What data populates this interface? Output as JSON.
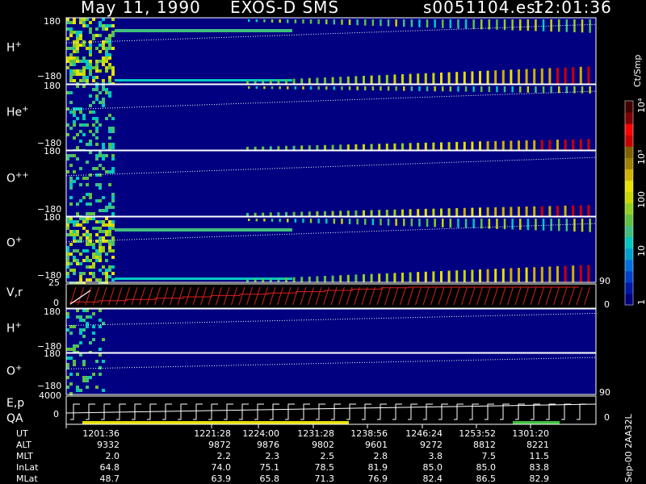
{
  "header": {
    "date": "May 11, 1990",
    "mission": "EXOS-D SMS",
    "file": "s0051104.esr",
    "time": "12:01:36"
  },
  "colorbar": {
    "unit": "Ct/Smp",
    "ticks": [
      "1",
      "10",
      "100",
      "10³",
      "10⁴"
    ],
    "colors": [
      "#000080",
      "#0018a8",
      "#0040d0",
      "#0070e0",
      "#00a0d0",
      "#00c8c0",
      "#40c080",
      "#60c040",
      "#90d020",
      "#c8d800",
      "#e8e000",
      "#d0b000",
      "#a08000",
      "#806000",
      "#cc0000",
      "#ff0000",
      "#800000",
      "#400000"
    ]
  },
  "panels": [
    {
      "label_main": "H",
      "label_sup": "+",
      "tick_top": "180",
      "tick_bottom": "−180"
    },
    {
      "label_main": "He",
      "label_sup": "+",
      "tick_top": "180",
      "tick_bottom": "−180"
    },
    {
      "label_main": "O",
      "label_sup": "++",
      "tick_top": "180",
      "tick_bottom": "−180"
    },
    {
      "label_main": "O",
      "label_sup": "+",
      "tick_top": "180",
      "tick_bottom": "−180",
      "right_tick": "90"
    },
    {
      "label_main": "V,r",
      "label_sup": "",
      "tick_top": "25",
      "tick_bottom": "0",
      "right_tick": "0"
    },
    {
      "label_main": "H",
      "label_sup": "+",
      "tick_top": "180",
      "tick_bottom": "−180"
    },
    {
      "label_main": "O",
      "label_sup": "+",
      "tick_top": "180",
      "tick_bottom": "−180",
      "right_tick": "90"
    },
    {
      "label_main": "E,p",
      "label_sub2": "QA",
      "tick_top": "4000",
      "tick_bottom": "0",
      "right_tick": "0"
    }
  ],
  "orbit_table": {
    "row_labels": [
      "UT",
      "ALT",
      "MLT",
      "InLat",
      "MLat"
    ],
    "columns": [
      {
        "UT": "1201:36",
        "ALT": "9332",
        "MLT": "2.0",
        "InLat": "64.8",
        "MLat": "48.7"
      },
      {
        "UT": "1221:28",
        "ALT": "9872",
        "MLT": "2.2",
        "InLat": "74.0",
        "MLat": "63.9"
      },
      {
        "UT": "1224:00",
        "ALT": "9876",
        "MLT": "2.3",
        "InLat": "75.1",
        "MLat": "65.8"
      },
      {
        "UT": "1231:28",
        "ALT": "9802",
        "MLT": "2.5",
        "InLat": "78.5",
        "MLat": "71.3"
      },
      {
        "UT": "1238:56",
        "ALT": "9601",
        "MLT": "2.8",
        "InLat": "81.9",
        "MLat": "76.9"
      },
      {
        "UT": "1246:24",
        "ALT": "9272",
        "MLT": "3.8",
        "InLat": "85.0",
        "MLat": "82.4"
      },
      {
        "UT": "1253:52",
        "ALT": "8812",
        "MLT": "7.5",
        "InLat": "85.0",
        "MLat": "86.5"
      },
      {
        "UT": "1301:20",
        "ALT": "8221",
        "MLT": "11.5",
        "InLat": "83.8",
        "MLat": "82.9"
      }
    ]
  },
  "side_note": "Sep-00 2AA32L",
  "chart_data": {
    "type": "heatmap",
    "title": "May 11, 1990 EXOS-D SMS",
    "x_time_labels": [
      "1201:36",
      "1221:28",
      "1224:00",
      "1231:28",
      "1238:56",
      "1246:24",
      "1253:52",
      "1301:20"
    ],
    "y_range_pitch": [
      -180,
      180
    ],
    "y_range_vr": [
      0,
      25
    ],
    "y_range_ep": [
      0,
      4000
    ],
    "colorbar_scale": "log",
    "colorbar_range": [
      1,
      10000
    ],
    "unit": "Ct/Smp"
  }
}
